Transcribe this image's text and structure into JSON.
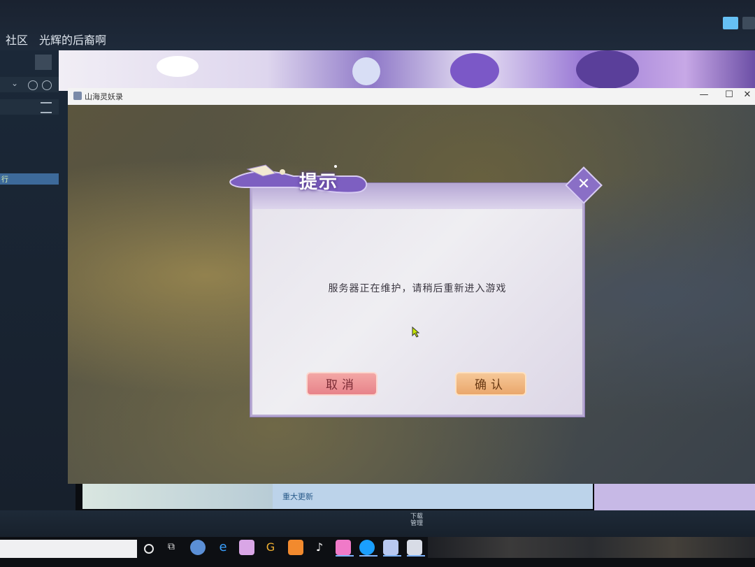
{
  "steam": {
    "nav_left": "社区",
    "profile_name": "光辉的后裔啊",
    "sidebar_active_fragment": "行",
    "news_title": "重大更新",
    "bottom_label": "下载\n管理"
  },
  "game_window": {
    "title": "山海灵妖录",
    "min_label": "—",
    "max_label": "☐",
    "close_label": "✕"
  },
  "dialog": {
    "title": "提示",
    "message": "服务器正在维护，请稍后重新进入游戏",
    "cancel_label": "取消",
    "confirm_label": "确认",
    "close_label": "✕"
  },
  "taskbar": {
    "icons": [
      "search-icon",
      "task-view-icon",
      "browser-icon",
      "edge-icon",
      "folder-icon",
      "chrome-icon",
      "app-icon",
      "tiktok-icon",
      "bilibili-icon",
      "steam-icon",
      "game-icon",
      "screen-icon"
    ]
  },
  "colors": {
    "dialog_border": "#b7a9d2",
    "cancel_button": "#e7838a",
    "confirm_button": "#eaa76c",
    "close_button": "#8a6fc6"
  }
}
